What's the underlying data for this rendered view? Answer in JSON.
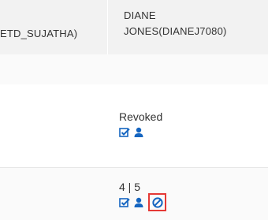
{
  "table": {
    "header": {
      "col1_label": "ETD_SUJATHA)",
      "col2_label_line1": "DIANE",
      "col2_label_line2": "JONES(DIANEJ7080)"
    },
    "rows": [
      {
        "status": ""
      },
      {
        "status": "Revoked",
        "icons": [
          "checkbox-check-icon",
          "user-icon"
        ]
      },
      {
        "status": "4 | 5",
        "icons": [
          "checkbox-check-icon",
          "user-icon",
          "ban-icon"
        ]
      }
    ]
  },
  "colors": {
    "accent": "#1565c0",
    "highlight": "#e53935",
    "header_bg": "#f2f2f2"
  }
}
